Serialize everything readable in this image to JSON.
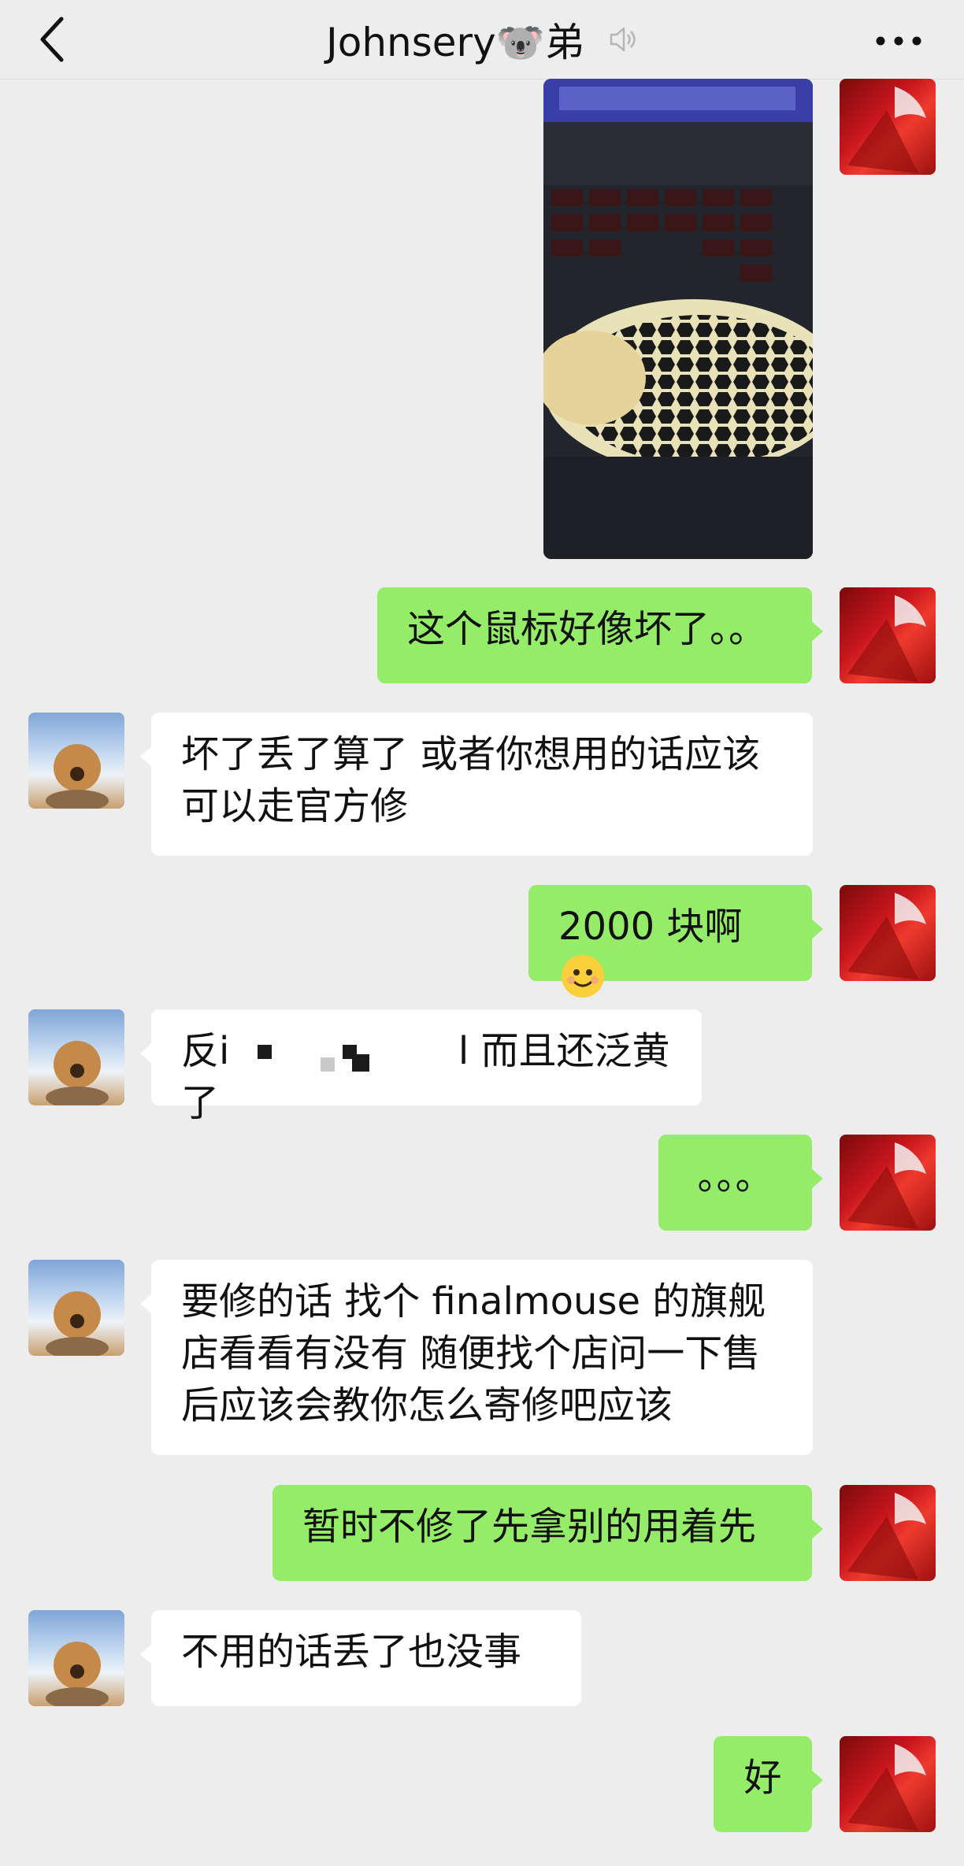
{
  "header": {
    "title": "Johnsery🐨弟",
    "back_icon": "chevron-left-icon",
    "mute_icon": "speaker-muted-icon",
    "more_icon": "more-dots-icon"
  },
  "messages": [
    {
      "sender": "me",
      "type": "image",
      "image_desc": "mouse-photo"
    },
    {
      "sender": "me",
      "type": "text",
      "text": "这个鼠标好像坏了。。"
    },
    {
      "sender": "friend",
      "type": "text",
      "lines": [
        "坏了丢了算了 或者你想用的话应该",
        "可以走官方修"
      ]
    },
    {
      "sender": "me",
      "type": "text",
      "text": "2000 块啊",
      "emoji": "smiling-face-icon"
    },
    {
      "sender": "friend",
      "type": "text",
      "text_before": "反i",
      "text_after": "l 而且还泛黄了",
      "redacted": true
    },
    {
      "sender": "me",
      "type": "text",
      "text": "。。。"
    },
    {
      "sender": "friend",
      "type": "text",
      "lines": [
        "要修的话 找个 finalmouse 的旗舰",
        "店看看有没有 随便找个店问一下售",
        "后应该会教你怎么寄修吧应该"
      ]
    },
    {
      "sender": "me",
      "type": "text",
      "text": "暂时不修了先拿别的用着先"
    },
    {
      "sender": "friend",
      "type": "text",
      "text": "不用的话丢了也没事"
    },
    {
      "sender": "me",
      "type": "text",
      "text": "好"
    }
  ],
  "colors": {
    "background": "#ededed",
    "my_bubble": "#95ec69",
    "friend_bubble": "#ffffff"
  }
}
